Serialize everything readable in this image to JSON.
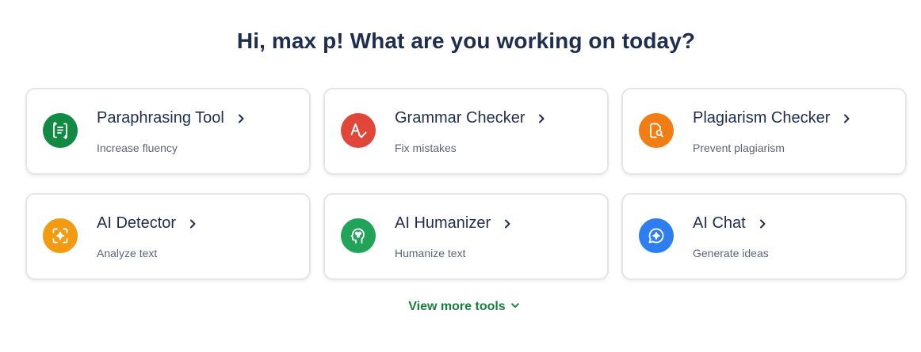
{
  "greeting": "Hi, max p! What are you working on today?",
  "tools": [
    {
      "title": "Paraphrasing Tool",
      "subtitle": "Increase fluency",
      "icon": "paraphrase-icon",
      "color": "#138a43"
    },
    {
      "title": "Grammar Checker",
      "subtitle": "Fix mistakes",
      "icon": "grammar-icon",
      "color": "#e0473a"
    },
    {
      "title": "Plagiarism Checker",
      "subtitle": "Prevent plagiarism",
      "icon": "plagiarism-icon",
      "color": "#f07e14"
    },
    {
      "title": "AI Detector",
      "subtitle": "Analyze text",
      "icon": "ai-detector-icon",
      "color": "#f29a12"
    },
    {
      "title": "AI Humanizer",
      "subtitle": "Humanize text",
      "icon": "humanizer-icon",
      "color": "#21a35a"
    },
    {
      "title": "AI Chat",
      "subtitle": "Generate ideas",
      "icon": "chat-icon",
      "color": "#2f7ef0"
    }
  ],
  "view_more": "View more tools",
  "colors": {
    "heading": "#1f2d4e",
    "link": "#16803c",
    "border": "#e3e5e9"
  }
}
